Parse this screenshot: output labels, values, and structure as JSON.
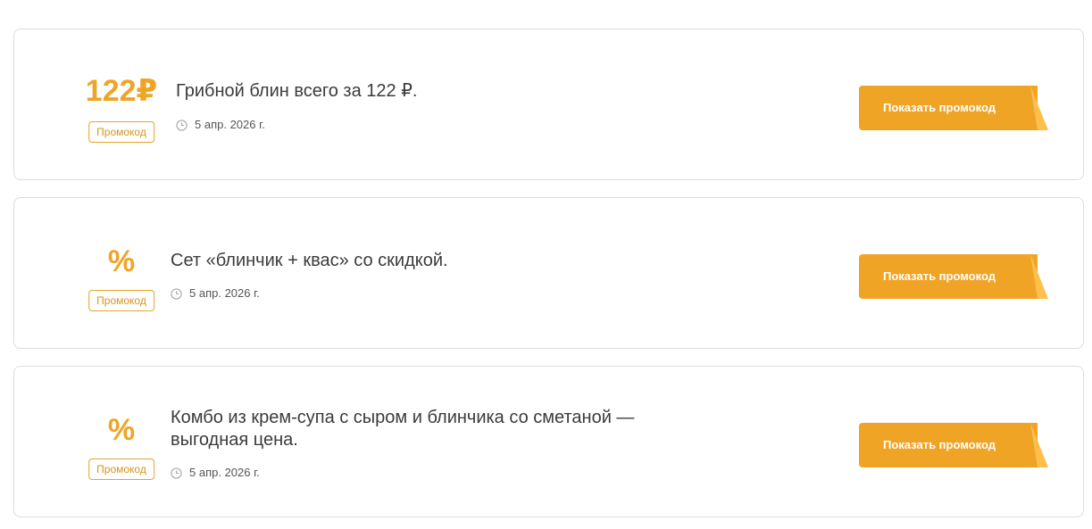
{
  "promos": [
    {
      "value": "122₽",
      "badge": "Промокод",
      "title": "Грибной блин всего за 122 ₽.",
      "date": "5 апр. 2026 г.",
      "button": "Показать промокод"
    },
    {
      "value": "%",
      "badge": "Промокод",
      "title": "Сет «блинчик + квас» со скидкой.",
      "date": "5 апр. 2026 г.",
      "button": "Показать промокод"
    },
    {
      "value": "%",
      "badge": "Промокод",
      "title": "Комбо из крем-супа с сыром и блинчика со сметаной — выгодная цена.",
      "date": "5 апр. 2026 г.",
      "button": "Показать промокод"
    }
  ],
  "colors": {
    "accent": "#f0a426",
    "accent_fold": "#ffbf4d",
    "border": "#dcdcdc"
  },
  "icons": [
    "clock-icon"
  ]
}
